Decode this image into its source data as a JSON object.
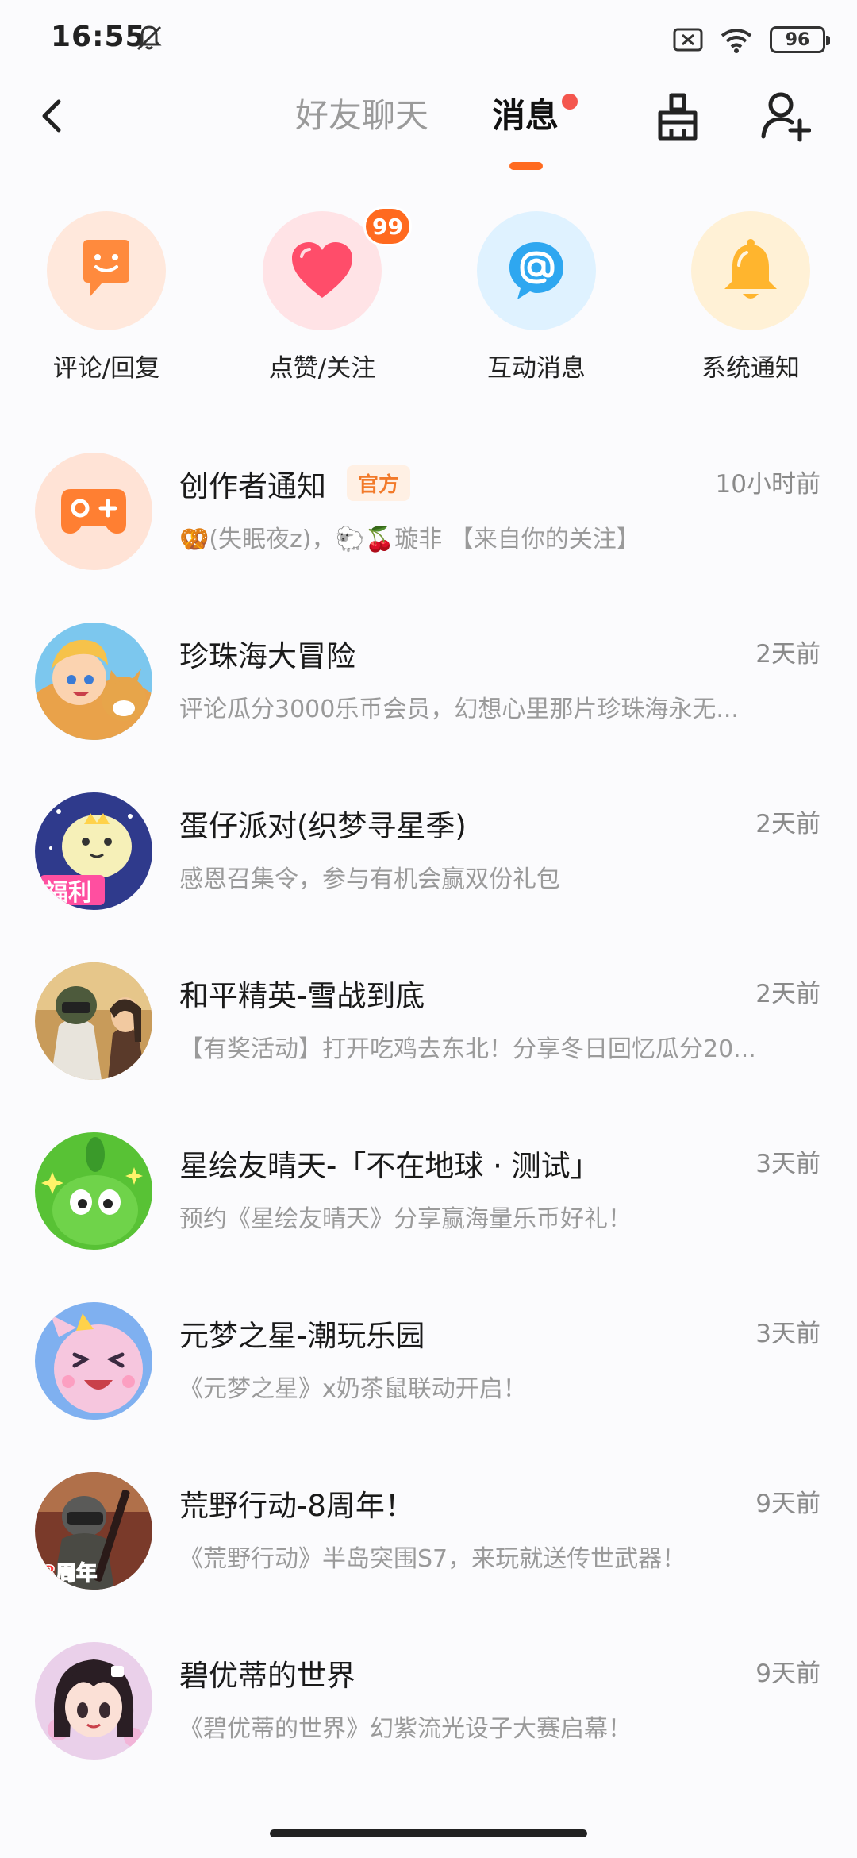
{
  "status_bar": {
    "time": "16:55",
    "battery": "96"
  },
  "header": {
    "tab_friends": "好友聊天",
    "tab_messages": "消息"
  },
  "quick_actions": [
    {
      "label": "评论/回复",
      "icon": "chat-smile-icon",
      "bg": "#ffe8dc",
      "fg": "#ff8a3d"
    },
    {
      "label": "点赞/关注",
      "icon": "heart-icon",
      "bg": "#ffe3e6",
      "fg": "#ff4d6a",
      "badge": "99"
    },
    {
      "label": "互动消息",
      "icon": "at-icon",
      "bg": "#dff2ff",
      "fg": "#2ea7f0"
    },
    {
      "label": "系统通知",
      "icon": "bell-icon",
      "bg": "#fff1d6",
      "fg": "#ffb52e"
    }
  ],
  "messages": [
    {
      "title": "创作者通知",
      "tag": "官方",
      "time": "10小时前",
      "preview": "🥨(失眠夜z)，🐑🍒璇非 【来自你的关注】",
      "avatar": "gamepad-avatar",
      "avatar_bg": "#ffe3d6"
    },
    {
      "title": "珍珠海大冒险",
      "time": "2天前",
      "preview": "评论瓜分3000乐币会员，幻想心里那片珍珠海永无...",
      "avatar": "game-avatar-pearl",
      "avatar_bg": "#f0b26a"
    },
    {
      "title": "蛋仔派对(织梦寻星季)",
      "time": "2天前",
      "preview": "感恩召集令，参与有机会赢双份礼包",
      "avatar": "game-avatar-eggy",
      "avatar_bg": "#3a3f8f"
    },
    {
      "title": "和平精英-雪战到底",
      "time": "2天前",
      "preview": "【有奖活动】打开吃鸡去东北！分享冬日回忆瓜分20...",
      "avatar": "game-avatar-peace",
      "avatar_bg": "#6b5a45"
    },
    {
      "title": "星绘友晴天-「不在地球 · 测试」",
      "time": "3天前",
      "preview": "预约《星绘友晴天》分享赢海量乐币好礼！",
      "avatar": "game-avatar-star",
      "avatar_bg": "#5cc83a"
    },
    {
      "title": "元梦之星-潮玩乐园",
      "time": "3天前",
      "preview": "《元梦之星》x奶茶鼠联动开启！",
      "avatar": "game-avatar-yuanmeng",
      "avatar_bg": "#f3b3d2"
    },
    {
      "title": "荒野行动-8周年！",
      "time": "9天前",
      "preview": "《荒野行动》半岛突围S7，来玩就送传世武器！",
      "avatar": "game-avatar-knives",
      "avatar_bg": "#8a4a3a"
    },
    {
      "title": "碧优蒂的世界",
      "time": "9天前",
      "preview": "《碧优蒂的世界》幻紫流光设子大赛启幕！",
      "avatar": "game-avatar-beauty",
      "avatar_bg": "#e9c8e4"
    }
  ]
}
